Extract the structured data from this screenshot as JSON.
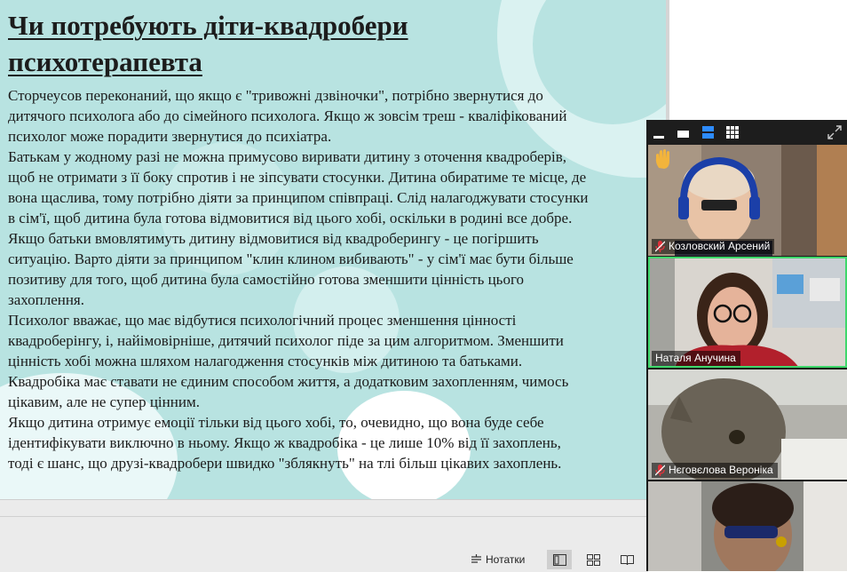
{
  "slide": {
    "title": "Чи потребують діти-квадробери\nпсихотерапевта",
    "paragraphs": [
      [
        "Сторчеусов переконаний, що якщо є \"тривожні дзвіночки\", потрібно звернутися до",
        "дитячого психолога або до сімейного психолога. Якщо ж зовсім треш - кваліфікований",
        "психолог може порадити звернутися до психіатра."
      ],
      [
        "Батькам у жодному разі не можна примусово виривати дитину з оточення квадроберів,",
        "щоб не отримати з її боку спротив і не зіпсувати стосунки. Дитина обиратиме те місце, де",
        "вона щаслива, тому потрібно діяти за принципом співпраці. Слід налагоджувати стосунки",
        "в сім'ї, щоб дитина була готова відмовитися від цього хобі, оскільки в родині все добре."
      ],
      [
        "Якщо батьки вмовлятимуть дитину відмовитися від квадроберингу - це погіршить",
        "ситуацію. Варто діяти за принципом \"клин клином вибивають\" - у сім'ї має бути більше",
        "позитиву для того, щоб дитина була самостійно готова зменшити цінність цього",
        "захоплення."
      ],
      [
        "Психолог вважає, що має відбутися психологічний процес зменшення цінності",
        "квадроберінгу, і, найімовірніше, дитячий психолог піде за цим алгоритмом. Зменшити",
        "цінність хобі можна шляхом налагодження стосунків між дитиною та батьками.",
        "Квадробіка має ставати не єдиним способом життя, а додатковим захопленням, чимось",
        "цікавим, але не супер цінним."
      ],
      [
        "Якщо дитина отримує емоції тільки від цього хобі, то, очевидно, що вона буде себе",
        "ідентифікувати виключно в ньому. Якщо ж квадробіка - це лише 10% від її захоплень,",
        "тоді є шанс, що друзі-квадробери швидко \"зблякнуть\" на тлі більш цікавих захоплень."
      ]
    ]
  },
  "statusbar": {
    "notes_label": "Нотатки",
    "notes_icon": "notes-icon",
    "view_icons": [
      "normal-view-icon",
      "slide-sorter-icon",
      "reading-view-icon"
    ]
  },
  "video_panel": {
    "toolbar_icons": [
      "minimize-icon",
      "thumbnail-view-icon",
      "speaker-view-icon",
      "gallery-view-icon",
      "fullscreen-icon"
    ],
    "participants": [
      {
        "name": "Козловский Арсений",
        "muted": true,
        "hand_raised": true,
        "active_speaker": false
      },
      {
        "name": "Наталя Анучина",
        "muted": false,
        "hand_raised": false,
        "active_speaker": true
      },
      {
        "name": "Нєговєлова Вероніка",
        "muted": true,
        "hand_raised": false,
        "active_speaker": false
      },
      {
        "name": "",
        "muted": false,
        "hand_raised": false,
        "active_speaker": false
      }
    ]
  },
  "colors": {
    "slide_bg": "#b8e3e1",
    "active_speaker_border": "#3ed86b",
    "muted_mic": "#e0313a",
    "hand_raise": "#f2b43c"
  }
}
